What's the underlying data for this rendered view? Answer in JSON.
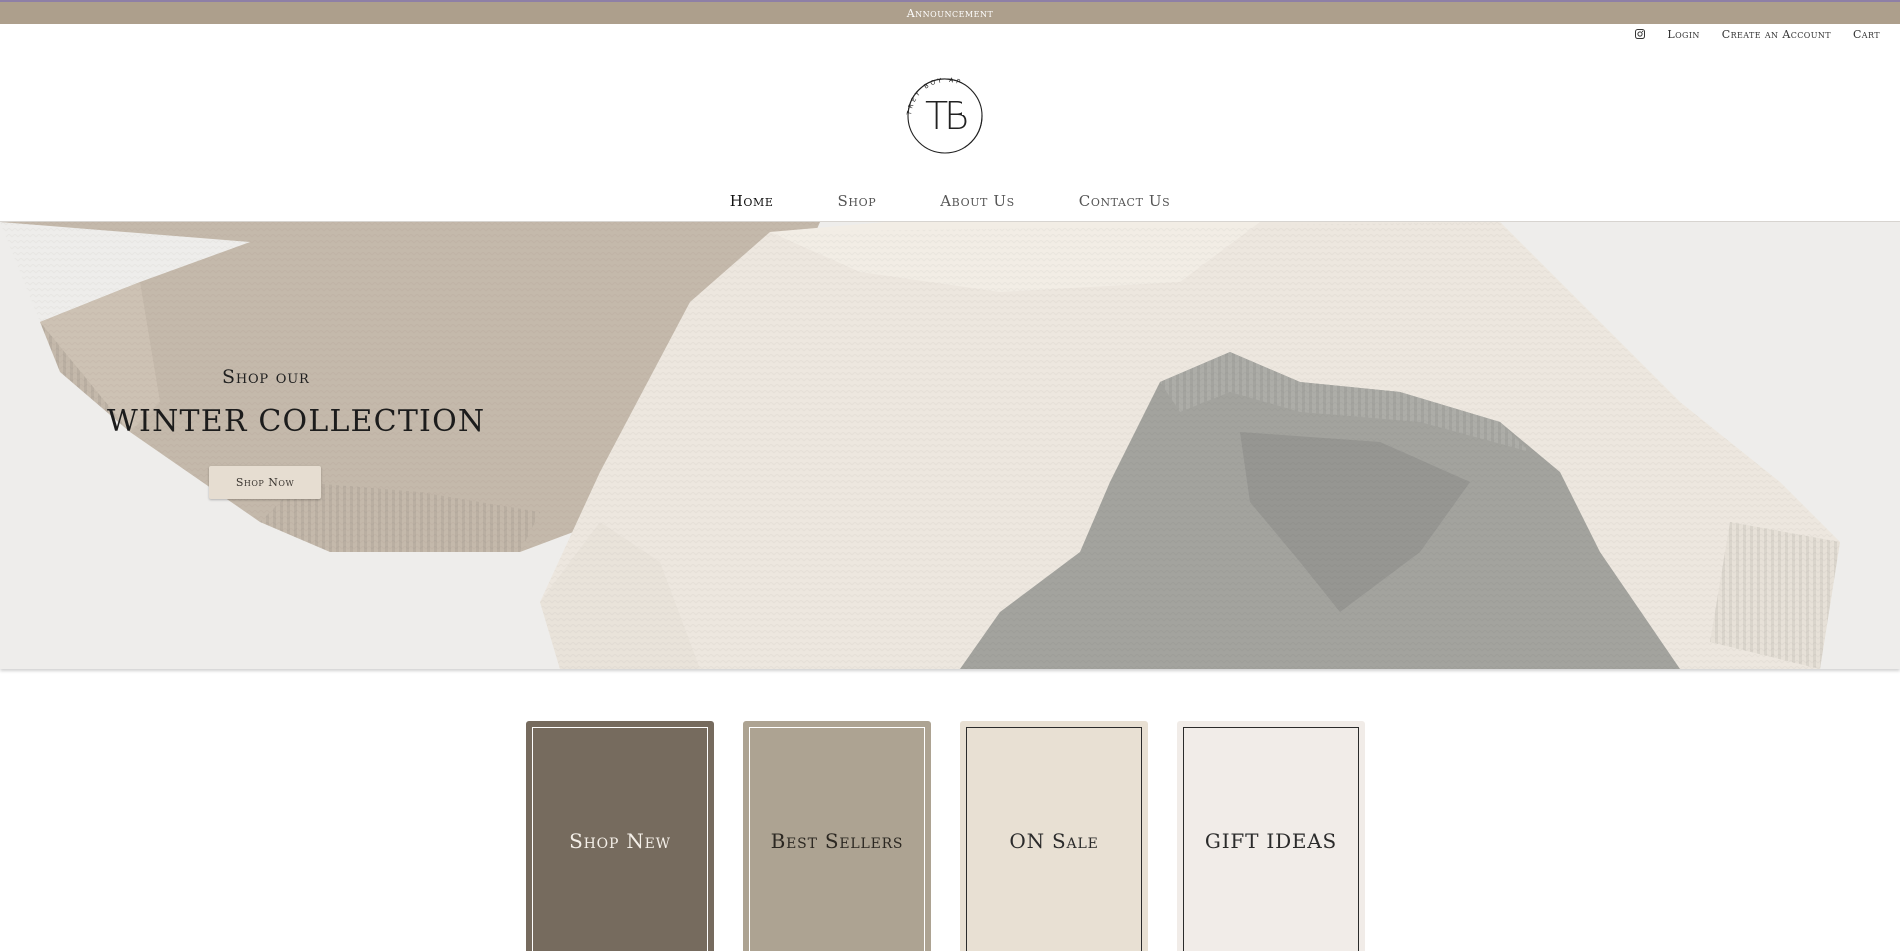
{
  "announcement": {
    "text": "Announcement"
  },
  "utility_nav": {
    "instagram_icon": "instagram-icon",
    "login": "Login",
    "create_account": "Create an Account",
    "cart": "Cart"
  },
  "brand": {
    "monogram": "TB",
    "circle_text": "TREY BOY APPAREL"
  },
  "main_nav": {
    "items": [
      {
        "label": "Home",
        "active": true
      },
      {
        "label": "Shop",
        "active": false
      },
      {
        "label": "About Us",
        "active": false
      },
      {
        "label": "Contact Us",
        "active": false
      }
    ]
  },
  "hero": {
    "kicker": "Shop our",
    "title": "WINTER COLLECTION",
    "button_label": "Shop Now"
  },
  "categories": [
    {
      "label": "Shop New",
      "color": "#766b5e"
    },
    {
      "label": "Best Sellers",
      "color": "#ada392"
    },
    {
      "label": "ON Sale",
      "color": "#e8e0d3"
    },
    {
      "label": "GIFT IDEAS",
      "color": "#f1ece8"
    }
  ],
  "colors": {
    "announcement_bar": "#ad9f8c",
    "hero_button": "#e6ddd1"
  }
}
